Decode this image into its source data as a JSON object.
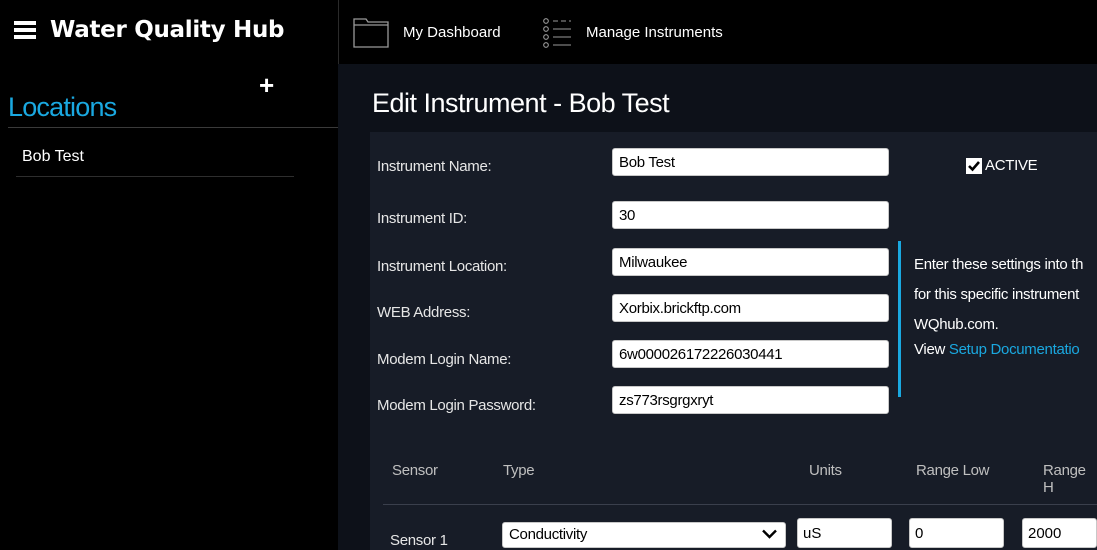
{
  "header": {
    "app_title": "Water Quality Hub",
    "nav": [
      {
        "label": "My Dashboard",
        "icon": "folder-icon"
      },
      {
        "label": "Manage Instruments",
        "icon": "list-icon"
      }
    ]
  },
  "sidebar": {
    "add_icon": "plus-icon",
    "title": "Locations",
    "items": [
      {
        "label": "Bob Test"
      }
    ]
  },
  "page": {
    "title": "Edit Instrument - Bob Test"
  },
  "form": {
    "fields": [
      {
        "label": "Instrument Name:",
        "value": "Bob Test"
      },
      {
        "label": "Instrument ID:",
        "value": "30"
      },
      {
        "label": "Instrument Location:",
        "value": "Milwaukee"
      },
      {
        "label": "WEB Address:",
        "value": "Xorbix.brickftp.com"
      },
      {
        "label": "Modem Login Name:",
        "value": "6w000026172226030441"
      },
      {
        "label": "Modem Login Password:",
        "value": "zs773rsgrgxryt"
      }
    ],
    "active": {
      "label": "ACTIVE",
      "checked": true
    }
  },
  "info": {
    "line1": "Enter these settings into th",
    "line2": "for this specific instrument",
    "line3": "WQhub.com.",
    "line4_prefix": "View ",
    "line4_link": "Setup Documentatio"
  },
  "sensor_table": {
    "headers": [
      "Sensor",
      "Type",
      "Units",
      "Range Low",
      "Range H"
    ],
    "rows": [
      {
        "sensor": "Sensor 1",
        "type": "Conductivity",
        "units": "uS",
        "range_low": "0",
        "range_high": "2000"
      }
    ]
  },
  "colors": {
    "accent": "#1aa8e0",
    "background": "#000000",
    "panel": "#171c27"
  }
}
